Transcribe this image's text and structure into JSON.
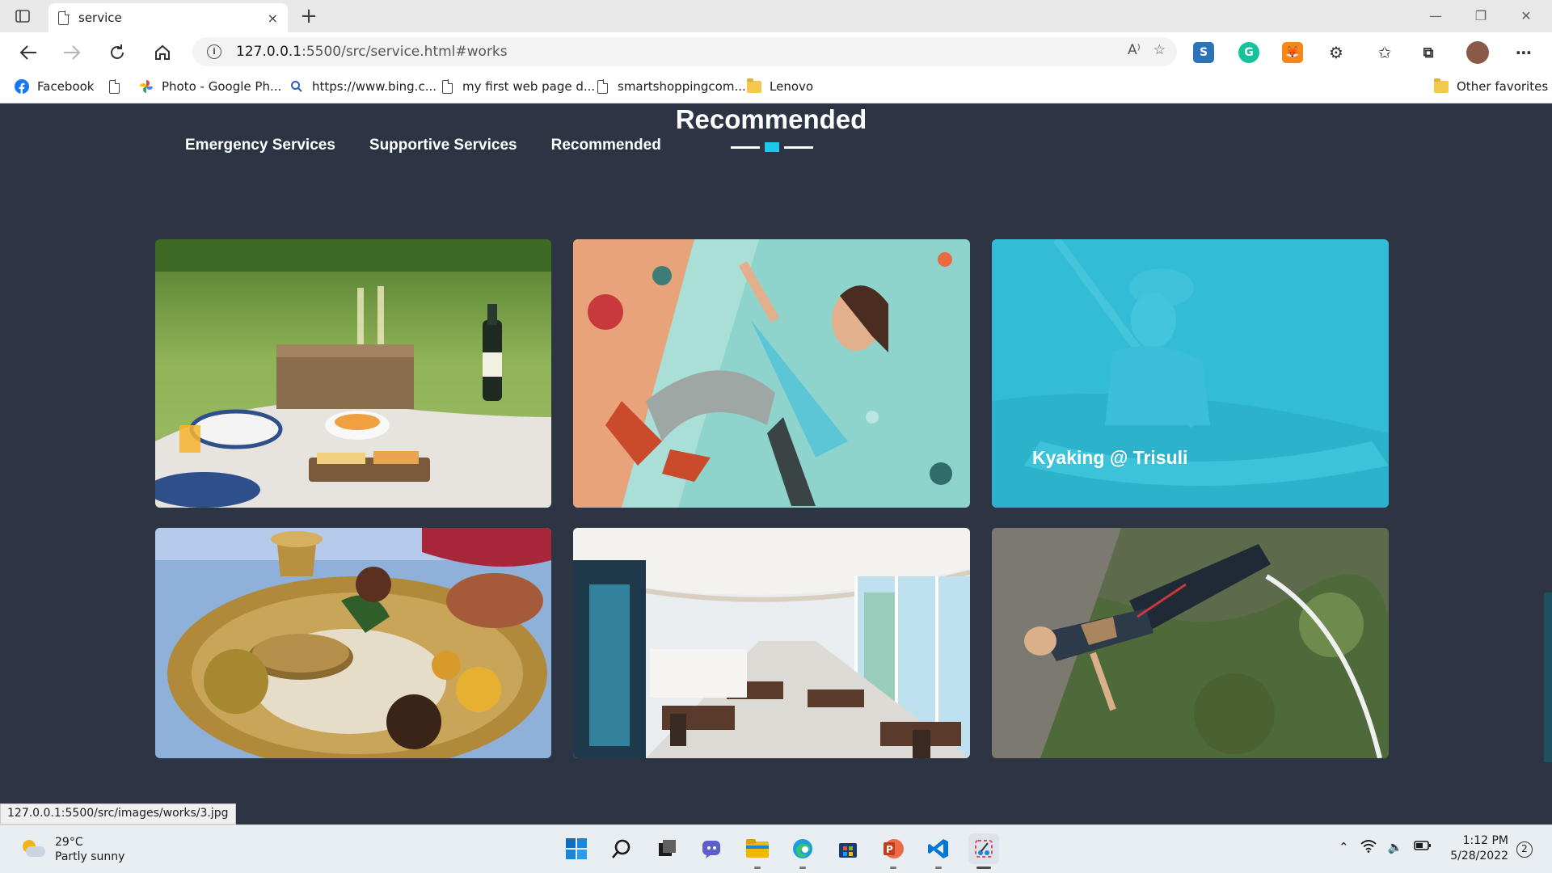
{
  "browser": {
    "tab_title": "service",
    "tab_close": "×",
    "new_tab": "+",
    "url_host": "127.0.0.1",
    "url_rest": ":5500/src/service.html#works",
    "read_aloud_glyph": "A⁾"
  },
  "bookmarks": [
    {
      "label": "Facebook",
      "icon": "facebook-icon"
    },
    {
      "label": "",
      "icon": "page-icon"
    },
    {
      "label": "Photo - Google Ph...",
      "icon": "google-photos-icon"
    },
    {
      "label": "https://www.bing.c...",
      "icon": "bing-search-icon"
    },
    {
      "label": "my first web page d...",
      "icon": "page-icon"
    },
    {
      "label": "smartshoppingcom...",
      "icon": "page-icon"
    },
    {
      "label": "Lenovo",
      "icon": "folder-icon"
    }
  ],
  "other_favorites": "Other favorites",
  "page": {
    "heading": "Recommended",
    "filters": [
      "Emergency Services",
      "Supportive Services",
      "Recommended"
    ],
    "gallery": [
      {
        "name": "picnic",
        "caption": ""
      },
      {
        "name": "climbing",
        "caption": ""
      },
      {
        "name": "kayaking",
        "caption": "Kyaking @ Trisuli"
      },
      {
        "name": "nepali-thali",
        "caption": ""
      },
      {
        "name": "restaurant",
        "caption": ""
      },
      {
        "name": "bungee",
        "caption": ""
      }
    ],
    "accent_color": "#1ec8e8",
    "background_color": "#2d3544"
  },
  "status_url": "127.0.0.1:5500/src/images/works/3.jpg",
  "taskbar": {
    "temperature": "29°C",
    "weather": "Partly sunny",
    "time": "1:12 PM",
    "date": "5/28/2022",
    "notifications": "2"
  }
}
